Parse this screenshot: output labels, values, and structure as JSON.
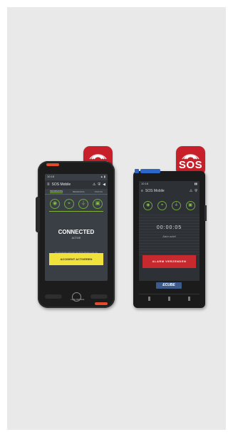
{
  "badge": {
    "label": "SOS",
    "color": "#c8202a",
    "icon": "signal-waves-icon"
  },
  "phone_left": {
    "status_time": "10:18",
    "status_icons": "▲ ▮",
    "app_title": "SOS Mobile",
    "tabs": [
      "INFORMATIE",
      "BEDIENING",
      "STATUS"
    ],
    "state": "CONNECTED",
    "state_sub": "ACTIVE",
    "note": "Dit apparaat verbindt via SOS Mobiel met uw beveiligingscentrale",
    "button_label": "ACCIDENT ACTIVEREN",
    "brand": "i.safe MOBILE"
  },
  "phone_right": {
    "status_time": "10:18",
    "app_title": "SOS Mobile",
    "timer": "00:00:05",
    "timer_sub": "Alarm actief",
    "button_label": "ALARM VERZENDEN",
    "logo": "ECUBE"
  }
}
